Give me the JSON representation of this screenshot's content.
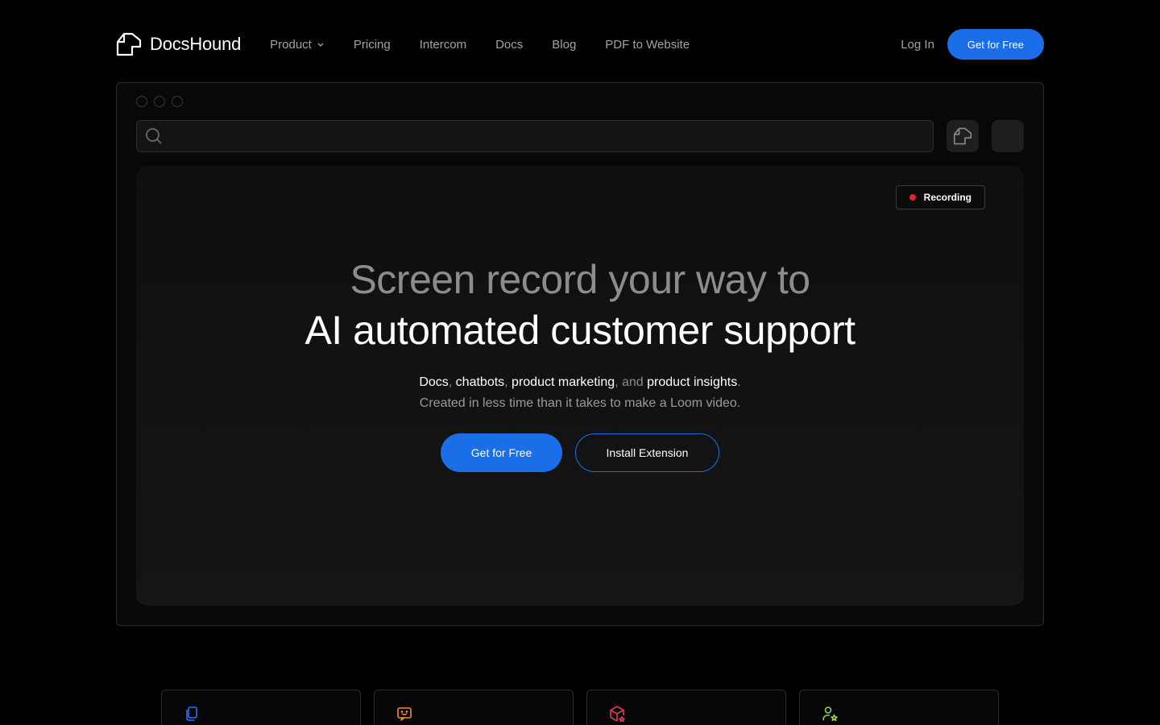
{
  "brand": {
    "name": "DocsHound",
    "logo_icon": "hound-head-icon"
  },
  "nav": {
    "items": [
      {
        "label": "Product",
        "has_dropdown": true
      },
      {
        "label": "Pricing"
      },
      {
        "label": "Intercom"
      },
      {
        "label": "Docs"
      },
      {
        "label": "Blog"
      },
      {
        "label": "PDF to Website"
      }
    ],
    "login_label": "Log In",
    "cta_label": "Get for Free"
  },
  "browser": {
    "search_icon": "search-icon",
    "extension_icon": "hound-head-icon"
  },
  "recording_badge": {
    "label": "Recording",
    "dot_color": "#e02424"
  },
  "hero": {
    "line1": "Screen record your way to",
    "line2": "AI automated customer support",
    "sub1": {
      "docs": "Docs",
      "comma1": ", ",
      "chatbots": "chatbots",
      "comma2": ", ",
      "marketing": "product marketing",
      "and": ", and ",
      "insights": "product insights",
      "period": "."
    },
    "sub2": "Created in less time than it takes to make a Loom video.",
    "primary_cta": "Get for Free",
    "secondary_cta": "Install Extension"
  },
  "feature_cards": [
    {
      "icon": "documents-icon",
      "color": "#2f6fed"
    },
    {
      "icon": "chatbot-icon",
      "color": "#f08a3c"
    },
    {
      "icon": "product-box-icon",
      "color": "#e8365c"
    },
    {
      "icon": "user-star-icon",
      "color": "#8fd14f"
    }
  ],
  "colors": {
    "accent": "#1a6fe8",
    "background": "#000000"
  }
}
